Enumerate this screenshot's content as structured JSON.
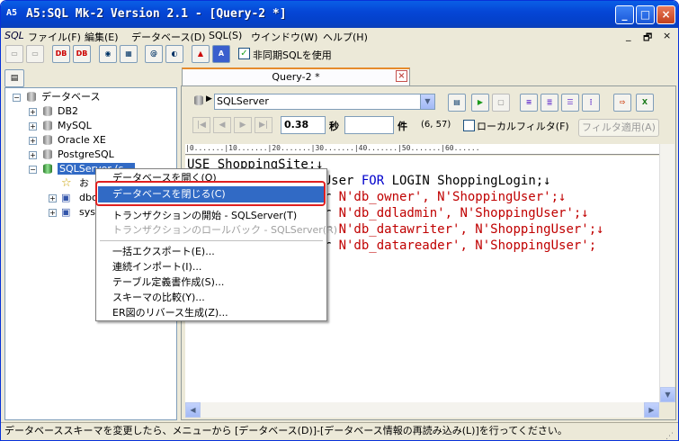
{
  "window": {
    "app_icon": "A5",
    "title": "A5:SQL Mk-2 Version 2.1 - [Query-2 *]",
    "minimize": "_",
    "maximize": "□",
    "close": "×"
  },
  "menu": {
    "sql_icon": "SQL",
    "items": [
      "ファイル(F)",
      "編集(E)",
      "データベース(D)",
      "SQL(S)",
      "ウインドウ(W)",
      "ヘルプ(H)"
    ],
    "mdi": [
      "_",
      "🗗",
      "×"
    ]
  },
  "toolbar": {
    "async_checkbox_label": "非同期SQLを使用",
    "async_checked": true,
    "db_button_labels": [
      "DB",
      "DB"
    ],
    "check_mark": "✓"
  },
  "tree": {
    "root": "データベース",
    "items": [
      "DB2",
      "MySQL",
      "Oracle XE",
      "PostgreSQL",
      "SQLServer (s..."
    ],
    "sub_items": [
      "お",
      "dbo",
      "sys"
    ],
    "expander_plus": "+",
    "expander_minus": "−"
  },
  "editor_tab": {
    "label": "Query-2 *",
    "close": "×"
  },
  "editor": {
    "connection": "SQLServer",
    "elapsed": "0.38",
    "seconds_unit": "秒",
    "rows_value": "",
    "rows_unit": "件",
    "cursor_pos": "(6, 57)",
    "local_filter_label": "ローカルフィルタ(F)",
    "local_filter_checked": false,
    "filter_apply_label": "フィルタ適用(A)",
    "ruler": "|0.......|10.......|20.......|30.......|40.......|50.......|60......",
    "code_lines": [
      {
        "pre": "USE ShoppingSite;↓",
        "kw": "",
        "post": "",
        "str": ""
      },
      {
        "pre": "                  User ",
        "kw": "FOR",
        "post": " LOGIN ShoppingLogin;↓",
        "str": ""
      },
      {
        "pre": "                  r ",
        "kw": "",
        "post": "",
        "str": "N'db_owner', N'ShoppingUser';↓"
      },
      {
        "pre": "                  r ",
        "kw": "",
        "post": "",
        "str": "N'db_ddladmin', N'ShoppingUser';↓"
      },
      {
        "pre": "                  r ",
        "kw": "",
        "post": "",
        "str": "N'db_datawriter', N'ShoppingUser';↓"
      },
      {
        "pre": "                  r ",
        "kw": "",
        "post": "",
        "str": "N'db_datareader', N'ShoppingUser';"
      }
    ]
  },
  "context_menu": {
    "items": [
      {
        "label": "データベースを開く(O)",
        "state": "normal"
      },
      {
        "label": "データベースを閉じる(C)",
        "state": "highlighted"
      },
      {
        "label": "トランザクションの開始 - SQLServer(T)",
        "state": "normal"
      },
      {
        "label": "トランザクションのロールバック - SQLServer(R)",
        "state": "disabled"
      },
      {
        "label": "一括エクスポート(E)...",
        "state": "normal"
      },
      {
        "label": "連続インポート(I)...",
        "state": "normal"
      },
      {
        "label": "テーブル定義書作成(S)...",
        "state": "normal"
      },
      {
        "label": "スキーマの比較(Y)...",
        "state": "normal"
      },
      {
        "label": "ER図のリバース生成(Z)...",
        "state": "normal"
      }
    ]
  },
  "status": {
    "text": "データベーススキーマを変更したら、メニューから [データベース(D)]-[データベース情報の再読み込み(L)]を行ってください。",
    "grip": "⋰"
  },
  "scrollbar": {
    "up": "▲",
    "down": "▼",
    "left": "◀",
    "right": "▶"
  },
  "colors": {
    "titlebar": "#0546d6",
    "selection": "#316ac5",
    "highlight_box": "#e02020",
    "keyword": "#0000cc",
    "string": "#c00000"
  }
}
